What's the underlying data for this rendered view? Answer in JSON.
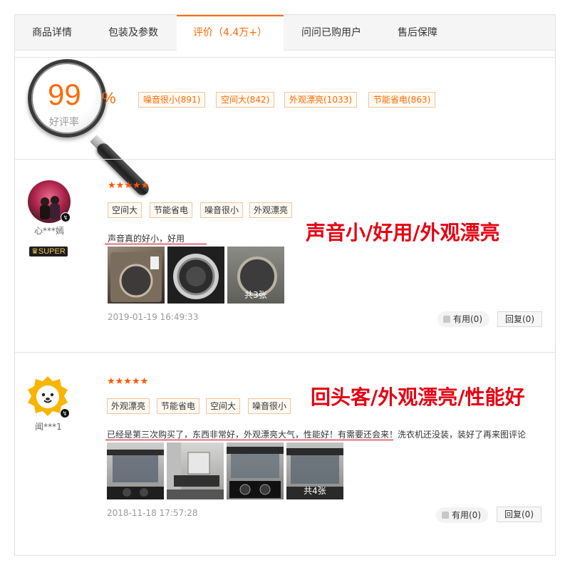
{
  "tabs": [
    {
      "label": "商品详情"
    },
    {
      "label": "包装及参数"
    },
    {
      "label": "评价（4.4万+）"
    },
    {
      "label": "问问已购用户"
    },
    {
      "label": "售后保障"
    }
  ],
  "rating": {
    "percent": "99",
    "percent_sign": "%",
    "label": "好评率",
    "tags": [
      "噪音很小(891)",
      "空间大(842)",
      "外观漂亮(1033)",
      "节能省电(863)"
    ]
  },
  "reviews": [
    {
      "username": "心***嫣",
      "super_badge": "SUPER",
      "stars": "★★★★★",
      "tags": [
        "空间大",
        "节能省电",
        "噪音很小",
        "外观漂亮"
      ],
      "text": "声音真的好小，好用",
      "text_extra": "",
      "image_count_label": "共3张",
      "date": "2019-01-19 16:49:33",
      "helpful_label": "有用(0)",
      "reply_label": "回复(0)",
      "annotation": "声音小/好用/外观漂亮"
    },
    {
      "username": "闻***1",
      "stars": "★★★★★",
      "tags": [
        "外观漂亮",
        "节能省电",
        "空间大",
        "噪音很小"
      ],
      "text": "已经是第三次购买了，东西非常好，外观漂亮大气，性能好！有需要还会来！",
      "text_extra": "洗衣机还没装，装好了再来图评论",
      "image_count_label": "共4张",
      "date": "2018-11-18 17:57:28",
      "helpful_label": "有用(0)",
      "reply_label": "回复(0)",
      "annotation": "回头客/外观漂亮/性能好"
    }
  ],
  "icons": {
    "magnifier": "magnifier-icon",
    "thumb": "thumbs-up-icon",
    "crown": "crown-icon",
    "user_level": "user-level-icon"
  },
  "colors": {
    "accent": "#ff6a00",
    "star": "#ff5500",
    "annotation": "#e60012"
  }
}
